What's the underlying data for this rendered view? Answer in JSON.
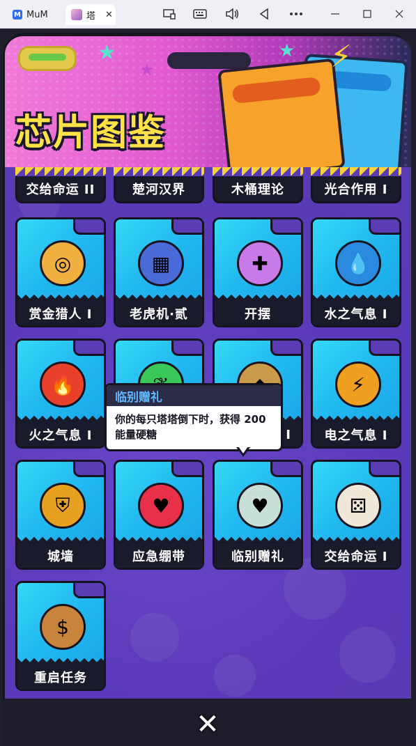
{
  "window": {
    "tabs": [
      {
        "label": "MuM",
        "active": false
      },
      {
        "label": "塔",
        "active": true
      }
    ],
    "close_glyph": "✕",
    "toolbar_icons": [
      "screen-icon",
      "keyboard-icon",
      "volume-icon",
      "back-icon",
      "more-icon",
      "minimize-icon",
      "maximize-icon",
      "close-icon"
    ]
  },
  "header": {
    "title": "芯片图鉴"
  },
  "top_row": [
    "交给命运 II",
    "楚河汉界",
    "木桶理论",
    "光合作用 I"
  ],
  "chips": [
    {
      "label": "赏金猎人 I",
      "icon": "bounty-hunter-icon",
      "color": "#f0b040"
    },
    {
      "label": "老虎机·贰",
      "icon": "slot-machine-icon",
      "color": "#4a6ad8"
    },
    {
      "label": "开摆",
      "icon": "gamepad-icon",
      "color": "#c87ae8"
    },
    {
      "label": "水之气息 I",
      "icon": "water-drop-icon",
      "color": "#2a8ae0"
    },
    {
      "label": "火之气息 I",
      "icon": "fire-icon",
      "color": "#e8402a"
    },
    {
      "label": "",
      "icon": "leaf-icon",
      "color": "#3ac85a"
    },
    {
      "label": "I",
      "icon": "earth-icon",
      "color": "#c89a4a"
    },
    {
      "label": "电之气息 I",
      "icon": "lightning-icon",
      "color": "#f0a020"
    },
    {
      "label": "城墙",
      "icon": "shield-icon",
      "color": "#e8a020"
    },
    {
      "label": "应急绷带",
      "icon": "bandage-heart-icon",
      "color": "#e8304a"
    },
    {
      "label": "临别赠礼",
      "icon": "farewell-gift-icon",
      "color": "#c8e0d8"
    },
    {
      "label": "交给命运 I",
      "icon": "dice-icon",
      "color": "#f0e8d8"
    },
    {
      "label": "重启任务",
      "icon": "money-bag-icon",
      "color": "#c8843a"
    }
  ],
  "tooltip": {
    "title": "临别赠礼",
    "description": "你的每只塔塔倒下时，获得 200  能量硬糖"
  },
  "close_button": "✕"
}
